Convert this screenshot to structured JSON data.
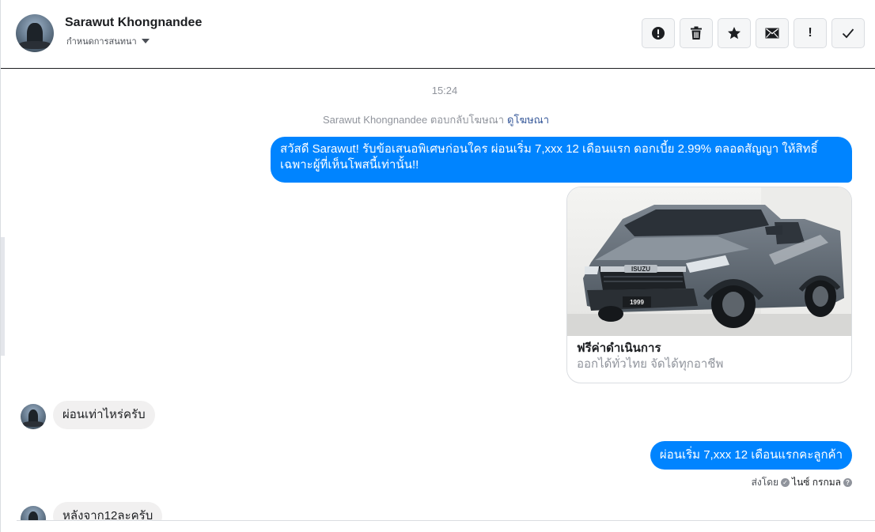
{
  "header": {
    "contact_name": "Sarawut Khongnandee",
    "label_dropdown": "กำหนดการสนทนา",
    "toolbar": {
      "spam_icon": "!",
      "move_icon": "!",
      "done_icon": "✓"
    }
  },
  "conversation": {
    "timestamp": "15:24",
    "ad_reply_text": "Sarawut Khongnandee ตอบกลับโฆษณา",
    "ad_reply_link": "ดูโฆษณา",
    "messages": [
      {
        "direction": "out",
        "text": "สวัสดี Sarawut! รับข้อเสนอพิเศษก่อนใคร ผ่อนเริ่ม 7,xxx 12 เดือนแรก ดอกเบี้ย 2.99% ตลอดสัญญา ให้สิทธิ์เฉพาะผู้ที่เห็นโพสนี้เท่านั้น!!"
      },
      {
        "direction": "in",
        "text": "ผ่อนเท่าไหร่ครับ"
      },
      {
        "direction": "out",
        "text": "ผ่อนเริ่ม 7,xxx 12 เดือนแรกคะลูกค้า"
      },
      {
        "direction": "in",
        "text": "หลังจาก12ละครับ"
      }
    ],
    "ad_card": {
      "title": "ฟรีค่าดำเนินการ",
      "subtitle": "ออกได้ทั่วไทย จัดได้ทุกอาชีพ",
      "brand_badge": "ISUZU",
      "plate": "1999"
    },
    "sent_by": {
      "prefix": "ส่งโดย",
      "agent": "ไนซ์ กรกมล",
      "help_icon": "?"
    }
  },
  "colors": {
    "outgoing_bubble": "#0084ff",
    "incoming_bubble": "#f1f0f0",
    "link": "#365899",
    "muted_text": "#90949c"
  },
  "icons": {
    "spam": "exclamation-circle-icon",
    "trash": "trash-icon",
    "star": "star-icon",
    "mail": "envelope-icon",
    "follow_up": "exclamation-icon",
    "done": "checkmark-icon"
  }
}
